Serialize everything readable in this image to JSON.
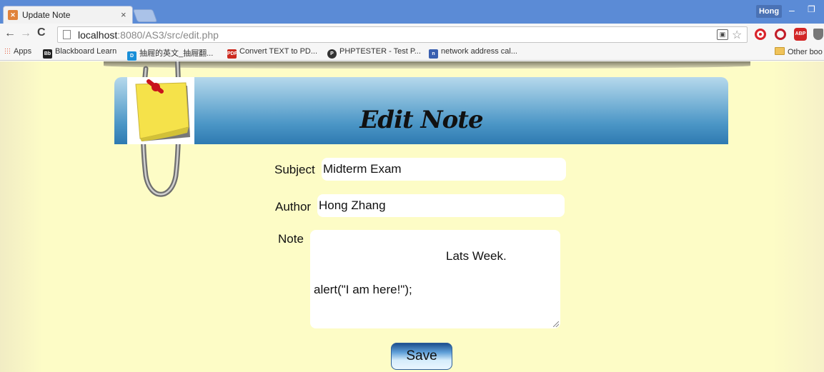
{
  "browser": {
    "tab_title": "Update Note",
    "tab_close": "×",
    "user": "Hong",
    "url_host": "localhost",
    "url_rest": ":8080/AS3/src/edit.php",
    "omnibox_icons": [
      "page-action-icon",
      "bookmark-star-icon"
    ],
    "extensions": [
      "stop-sign-icon",
      "block-icon",
      "adblock-plus-icon",
      "shield-icon"
    ]
  },
  "bookmarks": {
    "apps": "Apps",
    "items": [
      {
        "label": "Blackboard Learn",
        "icon": "Bb",
        "color": "#222222"
      },
      {
        "label": "抽屜的英文_抽屜翻...",
        "icon": "D",
        "color": "#1a8fd8"
      },
      {
        "label": "Convert TEXT to PD...",
        "icon": "PDF",
        "color": "#cc2a1f"
      },
      {
        "label": "PHPTESTER - Test P...",
        "icon": "P",
        "color": "#333333"
      },
      {
        "label": "network address cal...",
        "icon": "n",
        "color": "#3a60b0"
      }
    ],
    "other": "Other boo"
  },
  "page": {
    "title": "Edit Note",
    "subject_label": "Subject",
    "subject_value": "Midterm Exam",
    "author_label": "Author",
    "author_value": "Hong Zhang",
    "note_label": "Note",
    "note_line1": "Lats Week.",
    "note_line2": "alert(\"I am here!\");",
    "save_label": "Save"
  }
}
